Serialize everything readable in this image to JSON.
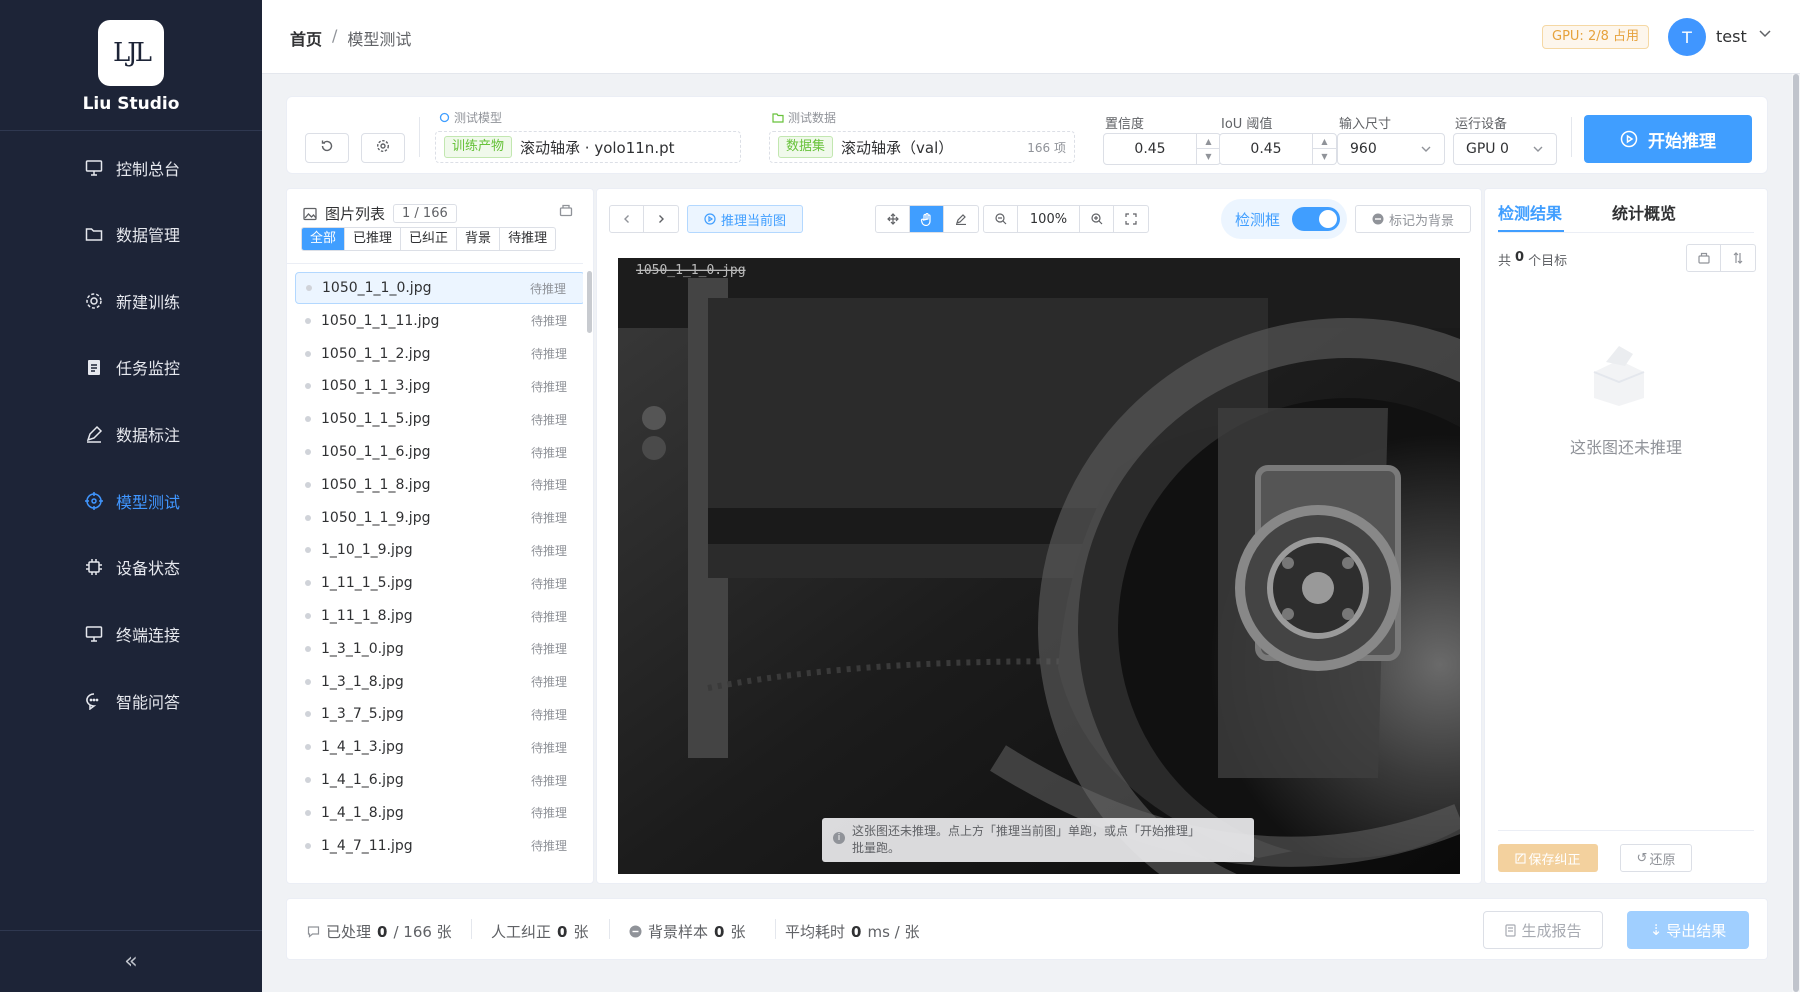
{
  "sidebar": {
    "logo_text": "LJL",
    "brand": "Liu Studio",
    "items": [
      {
        "label": "控制总台",
        "icon": "monitor-icon"
      },
      {
        "label": "数据管理",
        "icon": "folder-icon"
      },
      {
        "label": "新建训练",
        "icon": "gear-icon"
      },
      {
        "label": "任务监控",
        "icon": "clipboard-icon"
      },
      {
        "label": "数据标注",
        "icon": "pen-icon"
      },
      {
        "label": "模型测试",
        "icon": "target-icon",
        "active": true
      },
      {
        "label": "设备状态",
        "icon": "chip-icon"
      },
      {
        "label": "终端连接",
        "icon": "terminal-icon"
      },
      {
        "label": "智能问答",
        "icon": "chat-icon"
      }
    ],
    "collapse_label": "«"
  },
  "header": {
    "breadcrumb": {
      "home": "首页",
      "sep": "/",
      "current": "模型测试"
    },
    "gpu_badge": "GPU: 2/8 占用",
    "user": {
      "initial": "T",
      "name": "test"
    }
  },
  "toolbar": {
    "model": {
      "label": "测试模型",
      "tag": "训练产物",
      "value": "滚动轴承 · yolo11n.pt"
    },
    "data": {
      "label": "测试数据",
      "tag": "数据集",
      "value": "滚动轴承（val）",
      "count": "166 项"
    },
    "confidence": {
      "label": "置信度",
      "value": "0.45"
    },
    "iou": {
      "label": "IoU 阈值",
      "value": "0.45"
    },
    "input_size": {
      "label": "输入尺寸",
      "value": "960"
    },
    "device": {
      "label": "运行设备",
      "value": "GPU 0"
    },
    "start_button": "开始推理"
  },
  "file_list": {
    "title": "图片列表",
    "count": "1 / 166",
    "filters": [
      "全部",
      "已推理",
      "已纠正",
      "背景",
      "待推理"
    ],
    "active_filter": "全部",
    "files": [
      {
        "name": "1050_1_1_0.jpg",
        "status": "待推理"
      },
      {
        "name": "1050_1_1_11.jpg",
        "status": "待推理"
      },
      {
        "name": "1050_1_1_2.jpg",
        "status": "待推理"
      },
      {
        "name": "1050_1_1_3.jpg",
        "status": "待推理"
      },
      {
        "name": "1050_1_1_5.jpg",
        "status": "待推理"
      },
      {
        "name": "1050_1_1_6.jpg",
        "status": "待推理"
      },
      {
        "name": "1050_1_1_8.jpg",
        "status": "待推理"
      },
      {
        "name": "1050_1_1_9.jpg",
        "status": "待推理"
      },
      {
        "name": "1_10_1_9.jpg",
        "status": "待推理"
      },
      {
        "name": "1_11_1_5.jpg",
        "status": "待推理"
      },
      {
        "name": "1_11_1_8.jpg",
        "status": "待推理"
      },
      {
        "name": "1_3_1_0.jpg",
        "status": "待推理"
      },
      {
        "name": "1_3_1_8.jpg",
        "status": "待推理"
      },
      {
        "name": "1_3_7_5.jpg",
        "status": "待推理"
      },
      {
        "name": "1_4_1_3.jpg",
        "status": "待推理"
      },
      {
        "name": "1_4_1_6.jpg",
        "status": "待推理"
      },
      {
        "name": "1_4_1_8.jpg",
        "status": "待推理"
      },
      {
        "name": "1_4_7_11.jpg",
        "status": "待推理"
      }
    ]
  },
  "viewer": {
    "infer_current": "推理当前图",
    "zoom": "100%",
    "bbox_toggle": "检测框",
    "mark_background": "标记为背景",
    "image_overlay_name": "1050_1_1_0.jpg",
    "tip_line1": "这张图还未推理。点上方「推理当前图」单跑，或点「开始推理」",
    "tip_line2": "批量跑。"
  },
  "results": {
    "tab_detect": "检测结果",
    "tab_stats": "统计概览",
    "total_prefix": "共",
    "total_count": "0",
    "total_suffix": "个目标",
    "empty_text": "这张图还未推理",
    "save_button": "保存纠正",
    "restore_button": "还原"
  },
  "footer": {
    "processed_label": "已处理",
    "processed": "0",
    "processed_total": "/ 166 张",
    "manual_label": "人工纠正",
    "manual": "0",
    "manual_unit": "张",
    "bg_label": "背景样本",
    "bg": "0",
    "bg_unit": "张",
    "avg_label": "平均耗时",
    "avg": "0",
    "avg_unit": "ms / 张",
    "report_button": "生成报告",
    "export_button": "导出结果"
  },
  "colors": {
    "primary": "#409eff",
    "sidebar": "#1d2437",
    "success": "#67c23a",
    "warning": "#e6a23c"
  }
}
